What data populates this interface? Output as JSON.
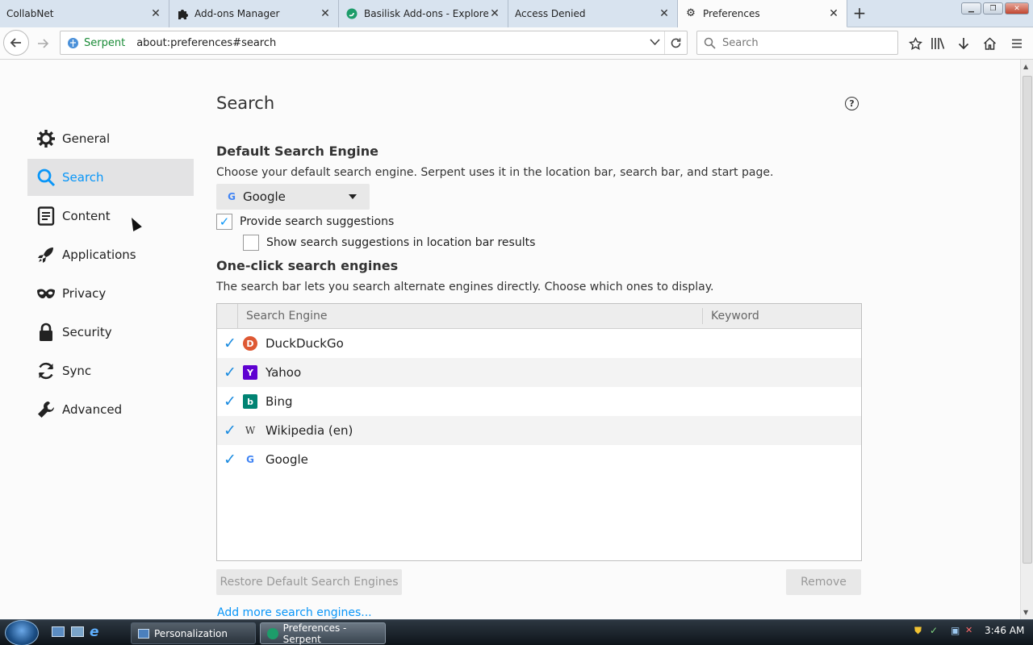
{
  "tabs": [
    {
      "label": "CollabNet",
      "icon": "none"
    },
    {
      "label": "Add-ons Manager",
      "icon": "puzzle-icon"
    },
    {
      "label": "Basilisk Add-ons - Explore A",
      "icon": "basilisk-icon"
    },
    {
      "label": "Access Denied",
      "icon": "none"
    },
    {
      "label": "Preferences",
      "icon": "gear-icon",
      "active": true
    }
  ],
  "navbar": {
    "site_label": "Serpent",
    "url": "about:preferences#search",
    "search_placeholder": "Search"
  },
  "sidebar": {
    "items": [
      {
        "label": "General",
        "icon": "gear-icon"
      },
      {
        "label": "Search",
        "icon": "search-icon",
        "active": true
      },
      {
        "label": "Content",
        "icon": "document-icon"
      },
      {
        "label": "Applications",
        "icon": "rocket-icon"
      },
      {
        "label": "Privacy",
        "icon": "mask-icon"
      },
      {
        "label": "Security",
        "icon": "lock-icon"
      },
      {
        "label": "Sync",
        "icon": "sync-icon"
      },
      {
        "label": "Advanced",
        "icon": "wrench-icon"
      }
    ]
  },
  "main": {
    "title": "Search",
    "default_engine": {
      "heading": "Default Search Engine",
      "description": "Choose your default search engine. Serpent uses it in the location bar, search bar, and start page.",
      "selected": "Google"
    },
    "suggestions": {
      "provide_label": "Provide search suggestions",
      "provide_checked": true,
      "location_label": "Show search suggestions in location bar results",
      "location_checked": false
    },
    "one_click": {
      "heading": "One-click search engines",
      "description": "The search bar lets you search alternate engines directly. Choose which ones to display.",
      "col_engine": "Search Engine",
      "col_keyword": "Keyword",
      "engines": [
        {
          "name": "DuckDuckGo",
          "icon": "duckduckgo-icon",
          "checked": true,
          "keyword": ""
        },
        {
          "name": "Yahoo",
          "icon": "yahoo-icon",
          "checked": true,
          "keyword": ""
        },
        {
          "name": "Bing",
          "icon": "bing-icon",
          "checked": true,
          "keyword": ""
        },
        {
          "name": "Wikipedia (en)",
          "icon": "wikipedia-icon",
          "checked": true,
          "keyword": ""
        },
        {
          "name": "Google",
          "icon": "google-icon",
          "checked": true,
          "keyword": ""
        }
      ]
    },
    "restore_button": "Restore Default Search Engines",
    "remove_button": "Remove",
    "add_more_link": "Add more search engines..."
  },
  "taskbar": {
    "items": [
      {
        "label": "Personalization"
      },
      {
        "label": "Preferences - Serpent",
        "active": true
      }
    ],
    "clock": "3:46 AM"
  },
  "colors": {
    "accent": "#0996f8",
    "check": "#1a8be0",
    "site_identity": "#1a8b37"
  }
}
